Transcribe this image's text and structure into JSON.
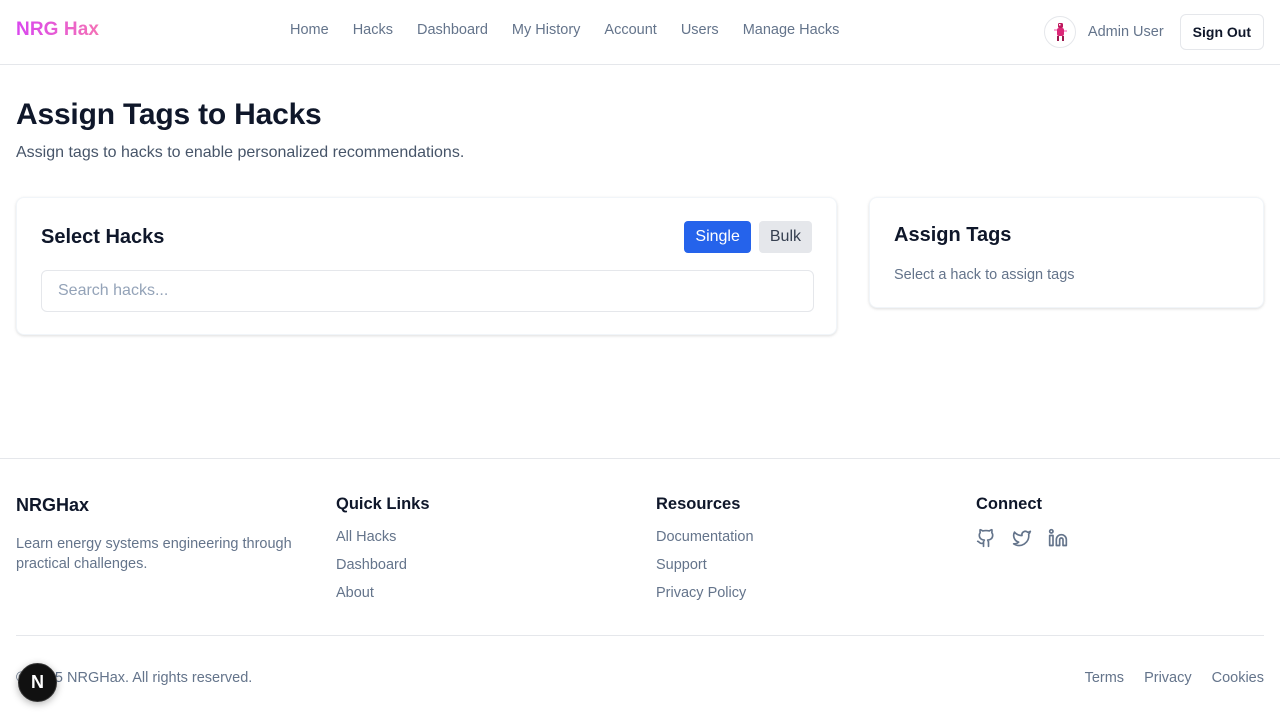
{
  "header": {
    "logo": "NRG Hax",
    "nav": [
      "Home",
      "Hacks",
      "Dashboard",
      "My History",
      "Account",
      "Users",
      "Manage Hacks"
    ],
    "user_name": "Admin User",
    "sign_out": "Sign Out"
  },
  "page": {
    "title": "Assign Tags to Hacks",
    "subtitle": "Assign tags to hacks to enable personalized recommendations."
  },
  "select_card": {
    "title": "Select Hacks",
    "mode_single": "Single",
    "mode_bulk": "Bulk",
    "active_mode": "Single",
    "search_placeholder": "Search hacks...",
    "search_value": ""
  },
  "assign_card": {
    "title": "Assign Tags",
    "hint": "Select a hack to assign tags"
  },
  "footer": {
    "brand": "NRGHax",
    "description": "Learn energy systems engineering through practical challenges.",
    "quick_links": {
      "heading": "Quick Links",
      "items": [
        "All Hacks",
        "Dashboard",
        "About"
      ]
    },
    "resources": {
      "heading": "Resources",
      "items": [
        "Documentation",
        "Support",
        "Privacy Policy"
      ]
    },
    "connect": {
      "heading": "Connect",
      "icons": [
        "github-icon",
        "twitter-icon",
        "linkedin-icon"
      ]
    },
    "copyright": "© 2025 NRGHax. All rights reserved.",
    "legal": [
      "Terms",
      "Privacy",
      "Cookies"
    ]
  },
  "dev_badge": {
    "letter": "N"
  },
  "colors": {
    "primary": "#2563eb",
    "logo_gradient_start": "#d946ef",
    "logo_gradient_end": "#f472b6",
    "muted_text": "#64748b"
  }
}
